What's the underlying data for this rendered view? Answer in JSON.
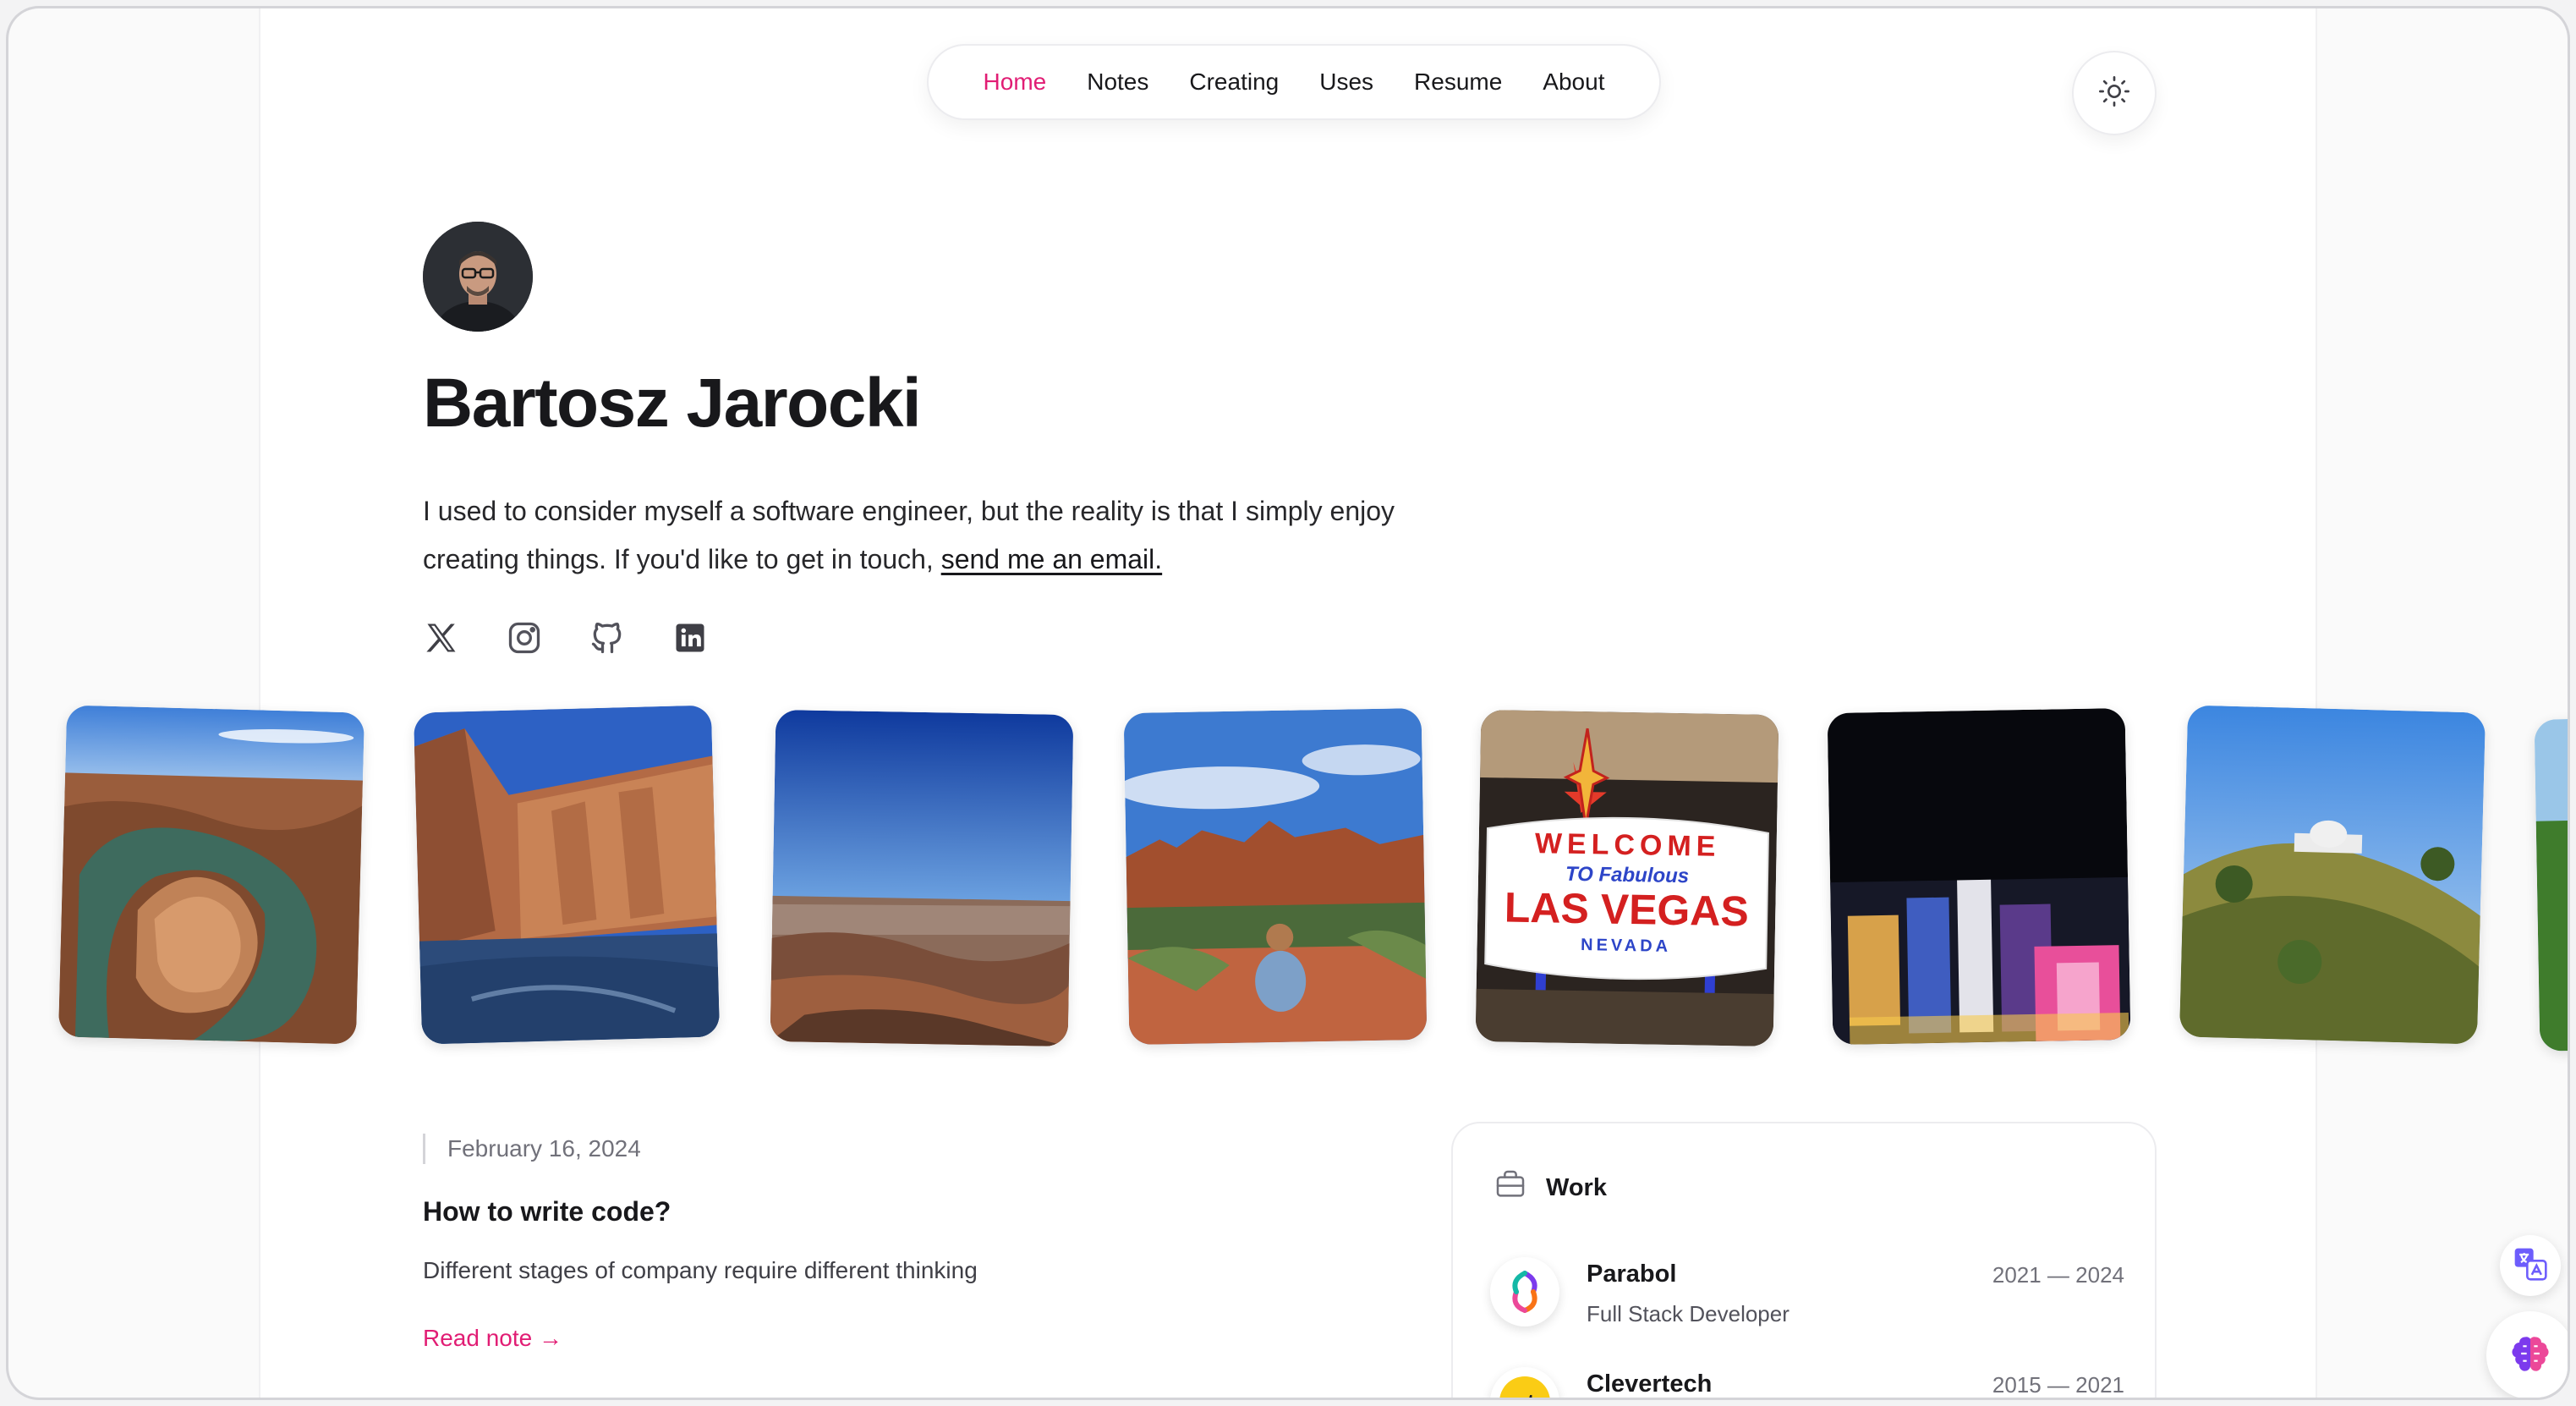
{
  "nav": {
    "items": [
      {
        "label": "Home",
        "active": true
      },
      {
        "label": "Notes",
        "active": false
      },
      {
        "label": "Creating",
        "active": false
      },
      {
        "label": "Uses",
        "active": false
      },
      {
        "label": "Resume",
        "active": false
      },
      {
        "label": "About",
        "active": false
      }
    ],
    "accent_color": "#e11d74"
  },
  "hero": {
    "name": "Bartosz Jarocki",
    "bio_text": "I used to consider myself a software engineer, but the reality is that I simply enjoy creating things. If you'd like to get in touch, ",
    "bio_link": "send me an email."
  },
  "socials": [
    "x-icon",
    "instagram-icon",
    "github-icon",
    "linkedin-icon"
  ],
  "photos": [
    {
      "subject": "horseshoe-bend"
    },
    {
      "subject": "lake-powell-canyon"
    },
    {
      "subject": "grand-canyon"
    },
    {
      "subject": "sedona-red-rocks"
    },
    {
      "subject": "welcome-to-las-vegas-sign"
    },
    {
      "subject": "las-vegas-night-skyline"
    },
    {
      "subject": "griffith-observatory-hill"
    }
  ],
  "sign": {
    "line1": "WELCOME",
    "line2": "TO Fabulous",
    "line3": "LAS VEGAS",
    "line4": "NEVADA"
  },
  "note": {
    "date": "February 16, 2024",
    "title": "How to write code?",
    "description": "Different stages of company require different thinking",
    "link": "Read note →"
  },
  "work": {
    "heading": "Work",
    "jobs": [
      {
        "company": "Parabol",
        "role": "Full Stack Developer",
        "years": "2021 — 2024"
      },
      {
        "company": "Clevertech",
        "role": "",
        "years": "2015 — 2021",
        "logo_text": "ct"
      }
    ]
  }
}
